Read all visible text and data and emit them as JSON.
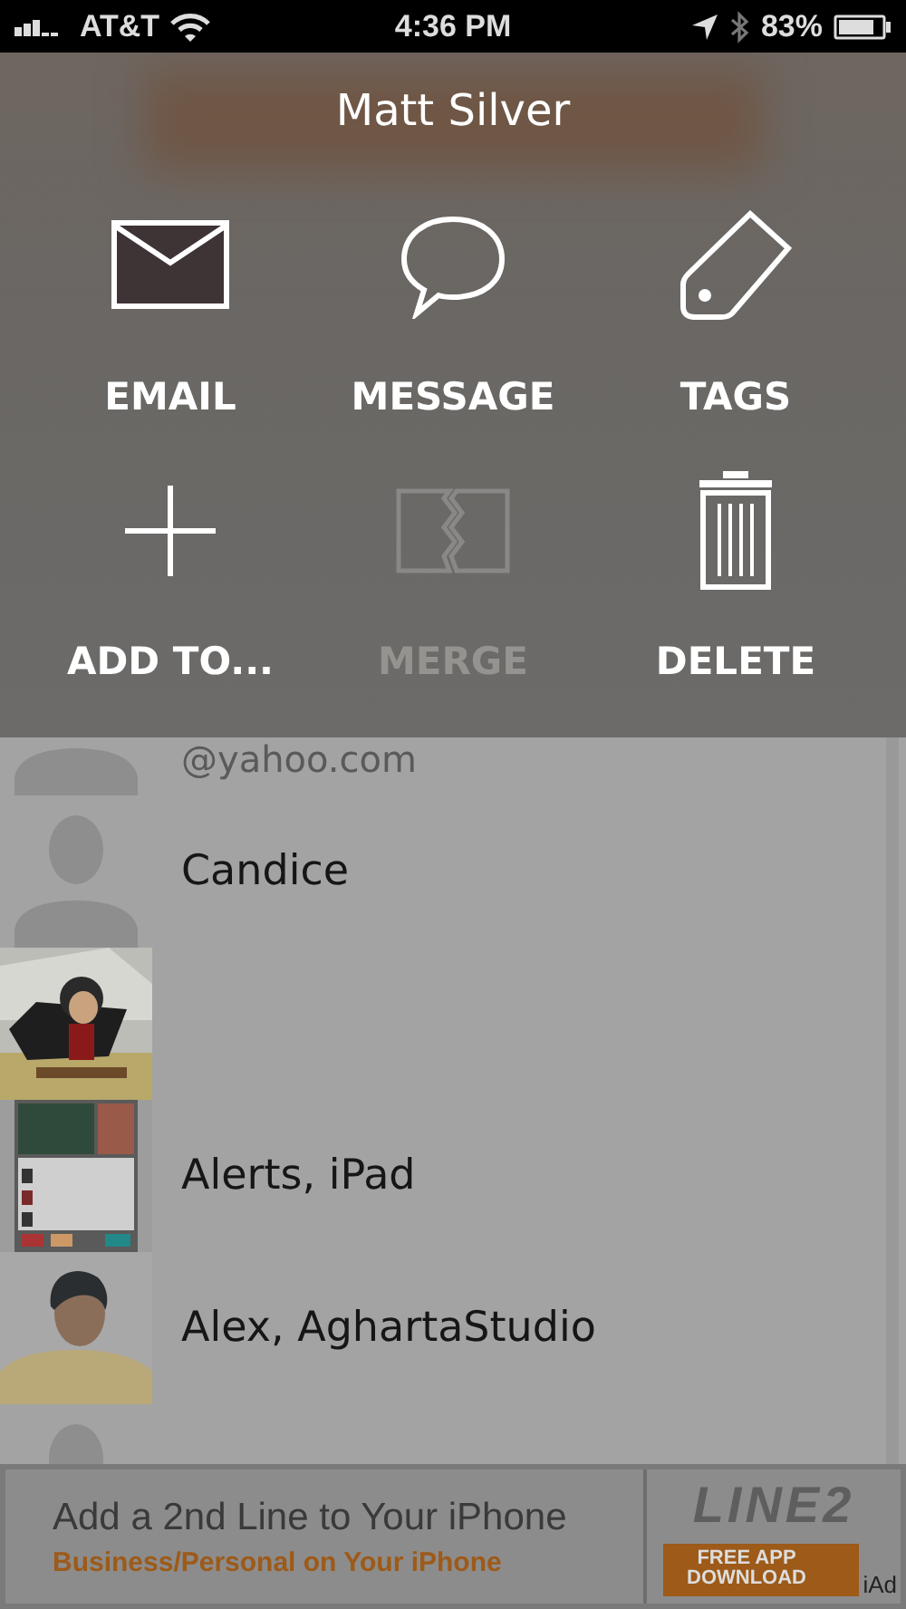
{
  "status_bar": {
    "carrier": "AT&T",
    "time": "4:36 PM",
    "battery": "83%"
  },
  "contact_menu": {
    "title": "Matt Silver",
    "actions": [
      {
        "label": "EMAIL",
        "kind": "email",
        "disabled": false
      },
      {
        "label": "MESSAGE",
        "kind": "message",
        "disabled": false
      },
      {
        "label": "TAGS",
        "kind": "tags",
        "disabled": false
      },
      {
        "label": "ADD TO...",
        "kind": "add",
        "disabled": false
      },
      {
        "label": "MERGE",
        "kind": "merge",
        "disabled": true
      },
      {
        "label": "DELETE",
        "kind": "delete",
        "disabled": false
      }
    ]
  },
  "contacts": [
    {
      "kind": "silhouette",
      "detail": "@yahoo.com"
    },
    {
      "kind": "silhouette",
      "name": "Candice"
    },
    {
      "kind": "cartoon"
    },
    {
      "kind": "screenshot",
      "name": "Alerts, iPad"
    },
    {
      "kind": "person",
      "name": "Alex, AghartaStudio"
    },
    {
      "kind": "silhouette"
    }
  ],
  "ad": {
    "headline": "Add a 2nd Line to Your iPhone",
    "subline": "Business/Personal on Your iPhone",
    "logo": "LINE2",
    "button": "FREE APP DOWNLOAD",
    "badge": "iAd"
  }
}
